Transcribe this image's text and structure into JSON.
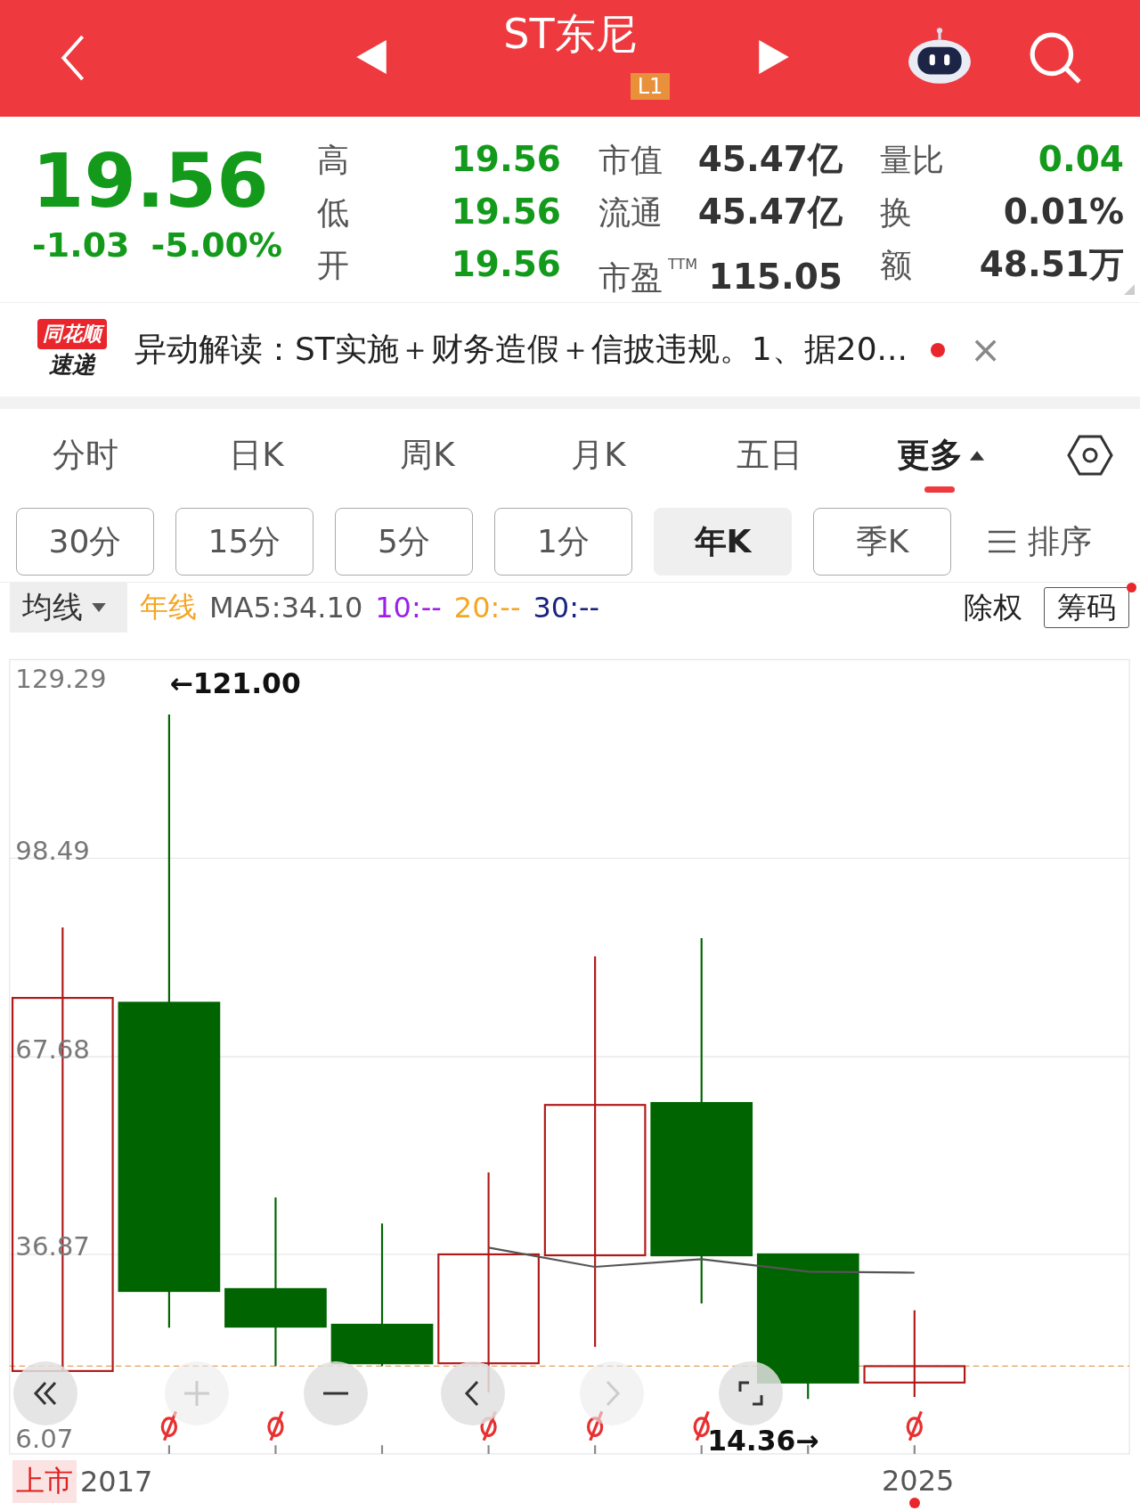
{
  "header": {
    "title": "ST东尼",
    "badge": "L1"
  },
  "quote": {
    "price": "19.56",
    "change": "-1.03",
    "change_pct": "-5.00%",
    "color": "#139a1b",
    "stats": [
      [
        {
          "label": "高",
          "value": "19.56",
          "color": "#139a1b"
        },
        {
          "label": "市值",
          "value": "45.47亿",
          "color": "#333333"
        },
        {
          "label": "量比",
          "value": "0.04",
          "color": "#139a1b"
        }
      ],
      [
        {
          "label": "低",
          "value": "19.56",
          "color": "#139a1b"
        },
        {
          "label": "流通",
          "value": "45.47亿",
          "color": "#333333"
        },
        {
          "label": "换",
          "value": "0.01%",
          "color": "#333333"
        }
      ],
      [
        {
          "label": "开",
          "value": "19.56",
          "color": "#139a1b"
        },
        {
          "label": "市盈$^{TTM}$",
          "value": "115.05",
          "color": "#333333"
        },
        {
          "label": "额",
          "value": "48.51万",
          "color": "#333333"
        }
      ]
    ]
  },
  "news": {
    "logo_top": "同花顺",
    "logo_bottom": "速递",
    "text": "异动解读：ST实施＋财务造假＋信披违规。1、据20...",
    "unread": true,
    "close": "×"
  },
  "tabs": [
    {
      "label": "分时",
      "selected": false,
      "kind": "plain"
    },
    {
      "label": "日K",
      "selected": false,
      "kind": "plain"
    },
    {
      "label": "周K",
      "selected": false,
      "kind": "plain"
    },
    {
      "label": "月K",
      "selected": false,
      "kind": "plain"
    },
    {
      "label": "五日",
      "selected": false,
      "kind": "plain"
    },
    {
      "label": "更多",
      "selected": true,
      "kind": "menu"
    }
  ],
  "periods": [
    {
      "label": "30分",
      "selected": false
    },
    {
      "label": "15分",
      "selected": false
    },
    {
      "label": "5分",
      "selected": false
    },
    {
      "label": "1分",
      "selected": false
    },
    {
      "label": "年K",
      "selected": true
    },
    {
      "label": "季K",
      "selected": false
    }
  ],
  "sort": {
    "label": "排序"
  },
  "indicators": {
    "dropdown": "均线",
    "items": [
      {
        "text": "年线",
        "color": "#f5a623"
      },
      {
        "text": "MA5:34.10",
        "color": "#555555"
      },
      {
        "text": "10:--",
        "color": "#9b1fe8"
      },
      {
        "text": "20:--",
        "color": "#f5a623"
      },
      {
        "text": "30:--",
        "color": "#1a237e"
      }
    ],
    "adjust": "除权",
    "chips": {
      "label": "筹码",
      "badge": true
    }
  },
  "chart": {
    "y_labels": [
      "129.29",
      "98.49",
      "67.68",
      "36.87",
      "6.07"
    ],
    "high_label": "←121.00",
    "low_label": "14.36→",
    "start_tag": "上市",
    "start_label": "2017",
    "end_label": "2025",
    "controls": [
      {
        "kind": "first",
        "disabled": false
      },
      {
        "kind": "zoom_in",
        "disabled": true
      },
      {
        "kind": "zoom_out",
        "disabled": false
      },
      {
        "kind": "prev",
        "disabled": false
      },
      {
        "kind": "next",
        "disabled": true
      },
      {
        "kind": "fullscreen",
        "disabled": false
      }
    ]
  }
}
